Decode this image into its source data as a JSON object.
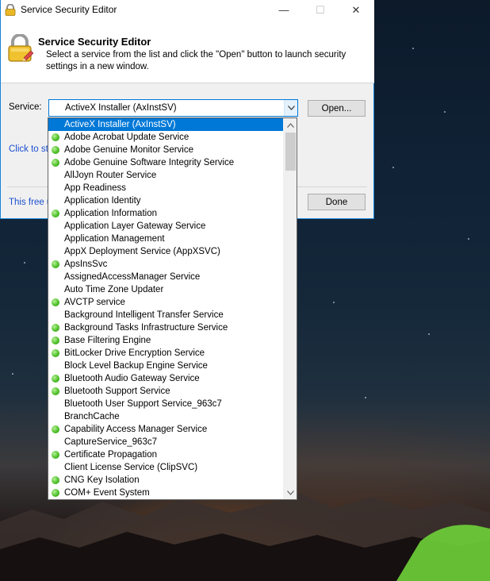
{
  "window": {
    "title": "Service Security Editor",
    "minimize_glyph": "—",
    "maximize_glyph": "☐",
    "close_glyph": "✕"
  },
  "header": {
    "title": "Service Security Editor",
    "description": "Select a service from the list and click the \"Open\" button to launch security settings in a new window."
  },
  "service": {
    "label": "Service:",
    "selected": "ActiveX Installer (AxInstSV)"
  },
  "buttons": {
    "open": "Open...",
    "done": "Done"
  },
  "links": {
    "click_to": "Click to sta",
    "free": "This free u"
  },
  "colors": {
    "accent": "#0078d7",
    "running_dot": "#4fc22a",
    "link": "#1a4fd0"
  },
  "dropdown": {
    "items": [
      {
        "label": "ActiveX Installer (AxInstSV)",
        "running": false,
        "selected": true
      },
      {
        "label": "Adobe Acrobat Update Service",
        "running": true
      },
      {
        "label": "Adobe Genuine Monitor Service",
        "running": true
      },
      {
        "label": "Adobe Genuine Software Integrity Service",
        "running": true
      },
      {
        "label": "AllJoyn Router Service",
        "running": false
      },
      {
        "label": "App Readiness",
        "running": false
      },
      {
        "label": "Application Identity",
        "running": false
      },
      {
        "label": "Application Information",
        "running": true
      },
      {
        "label": "Application Layer Gateway Service",
        "running": false
      },
      {
        "label": "Application Management",
        "running": false
      },
      {
        "label": "AppX Deployment Service (AppXSVC)",
        "running": false
      },
      {
        "label": "ApsInsSvc",
        "running": true
      },
      {
        "label": "AssignedAccessManager Service",
        "running": false
      },
      {
        "label": "Auto Time Zone Updater",
        "running": false
      },
      {
        "label": "AVCTP service",
        "running": true
      },
      {
        "label": "Background Intelligent Transfer Service",
        "running": false
      },
      {
        "label": "Background Tasks Infrastructure Service",
        "running": true
      },
      {
        "label": "Base Filtering Engine",
        "running": true
      },
      {
        "label": "BitLocker Drive Encryption Service",
        "running": true
      },
      {
        "label": "Block Level Backup Engine Service",
        "running": false
      },
      {
        "label": "Bluetooth Audio Gateway Service",
        "running": true
      },
      {
        "label": "Bluetooth Support Service",
        "running": true
      },
      {
        "label": "Bluetooth User Support Service_963c7",
        "running": false
      },
      {
        "label": "BranchCache",
        "running": false
      },
      {
        "label": "Capability Access Manager Service",
        "running": true
      },
      {
        "label": "CaptureService_963c7",
        "running": false
      },
      {
        "label": "Certificate Propagation",
        "running": true
      },
      {
        "label": "Client License Service (ClipSVC)",
        "running": false
      },
      {
        "label": "CNG Key Isolation",
        "running": true
      },
      {
        "label": "COM+ Event System",
        "running": true
      }
    ]
  }
}
